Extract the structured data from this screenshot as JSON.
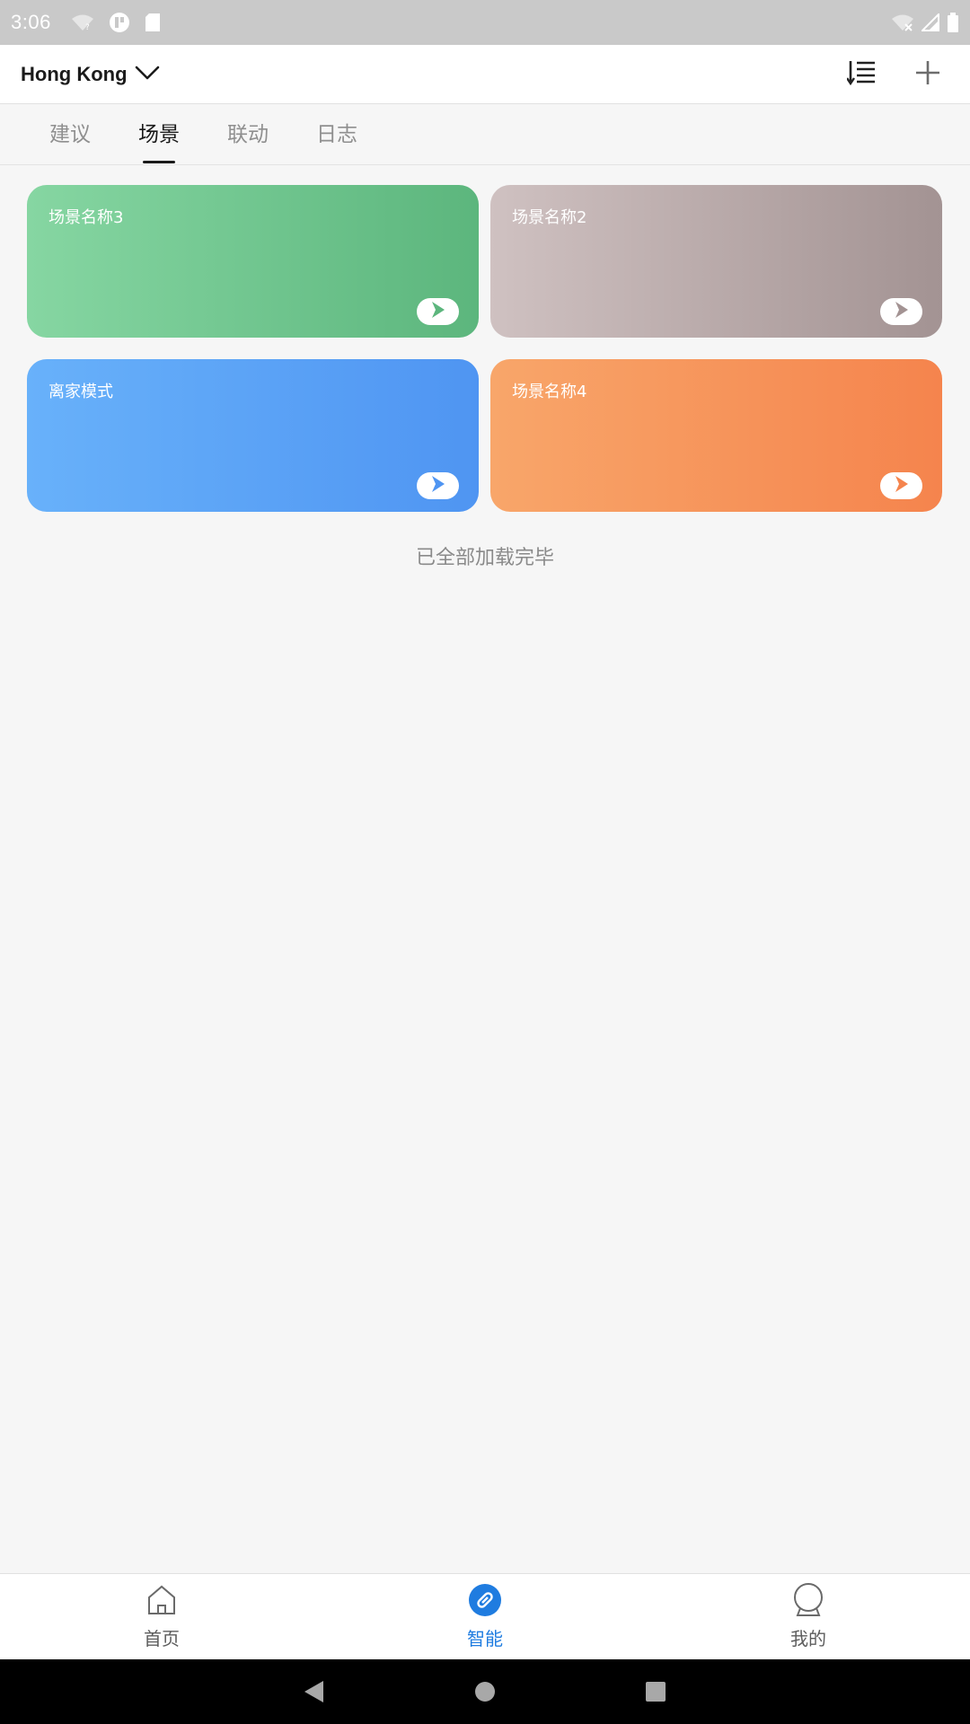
{
  "status_bar": {
    "time": "3:06",
    "left_icons": [
      "wifi-question-icon",
      "app-notification-icon",
      "sd-card-icon"
    ],
    "right_icons": [
      "wifi-off-icon",
      "signal-icon",
      "battery-icon"
    ]
  },
  "header": {
    "location": "Hong Kong",
    "actions": [
      "sort-list-icon",
      "plus-icon"
    ]
  },
  "tabs": [
    {
      "label": "建议"
    },
    {
      "label": "场景"
    },
    {
      "label": "联动"
    },
    {
      "label": "日志"
    }
  ],
  "active_tab": "场景",
  "scenes": [
    {
      "name": "场景名称3",
      "gradient": [
        "#86d6a2",
        "#5cb67d"
      ],
      "accent": "#5cb67d"
    },
    {
      "name": "场景名称2",
      "gradient": [
        "#cfc1c1",
        "#a39393"
      ],
      "accent": "#a39393"
    },
    {
      "name": "离家模式",
      "gradient": [
        "#68b1fa",
        "#4f95f2"
      ],
      "accent": "#4f95f2"
    },
    {
      "name": "场景名称4",
      "gradient": [
        "#f8a66a",
        "#f5844d"
      ],
      "accent": "#f5844d"
    }
  ],
  "load_status": "已全部加载完毕",
  "bottom_nav": {
    "items": [
      {
        "label": "首页",
        "icon": "home-icon"
      },
      {
        "label": "智能",
        "icon": "smart-link-icon"
      },
      {
        "label": "我的",
        "icon": "profile-icon"
      }
    ],
    "active": "智能",
    "active_color": "#1f7ce0"
  },
  "system_nav": [
    "back-icon",
    "home-circle-icon",
    "recents-square-icon"
  ]
}
